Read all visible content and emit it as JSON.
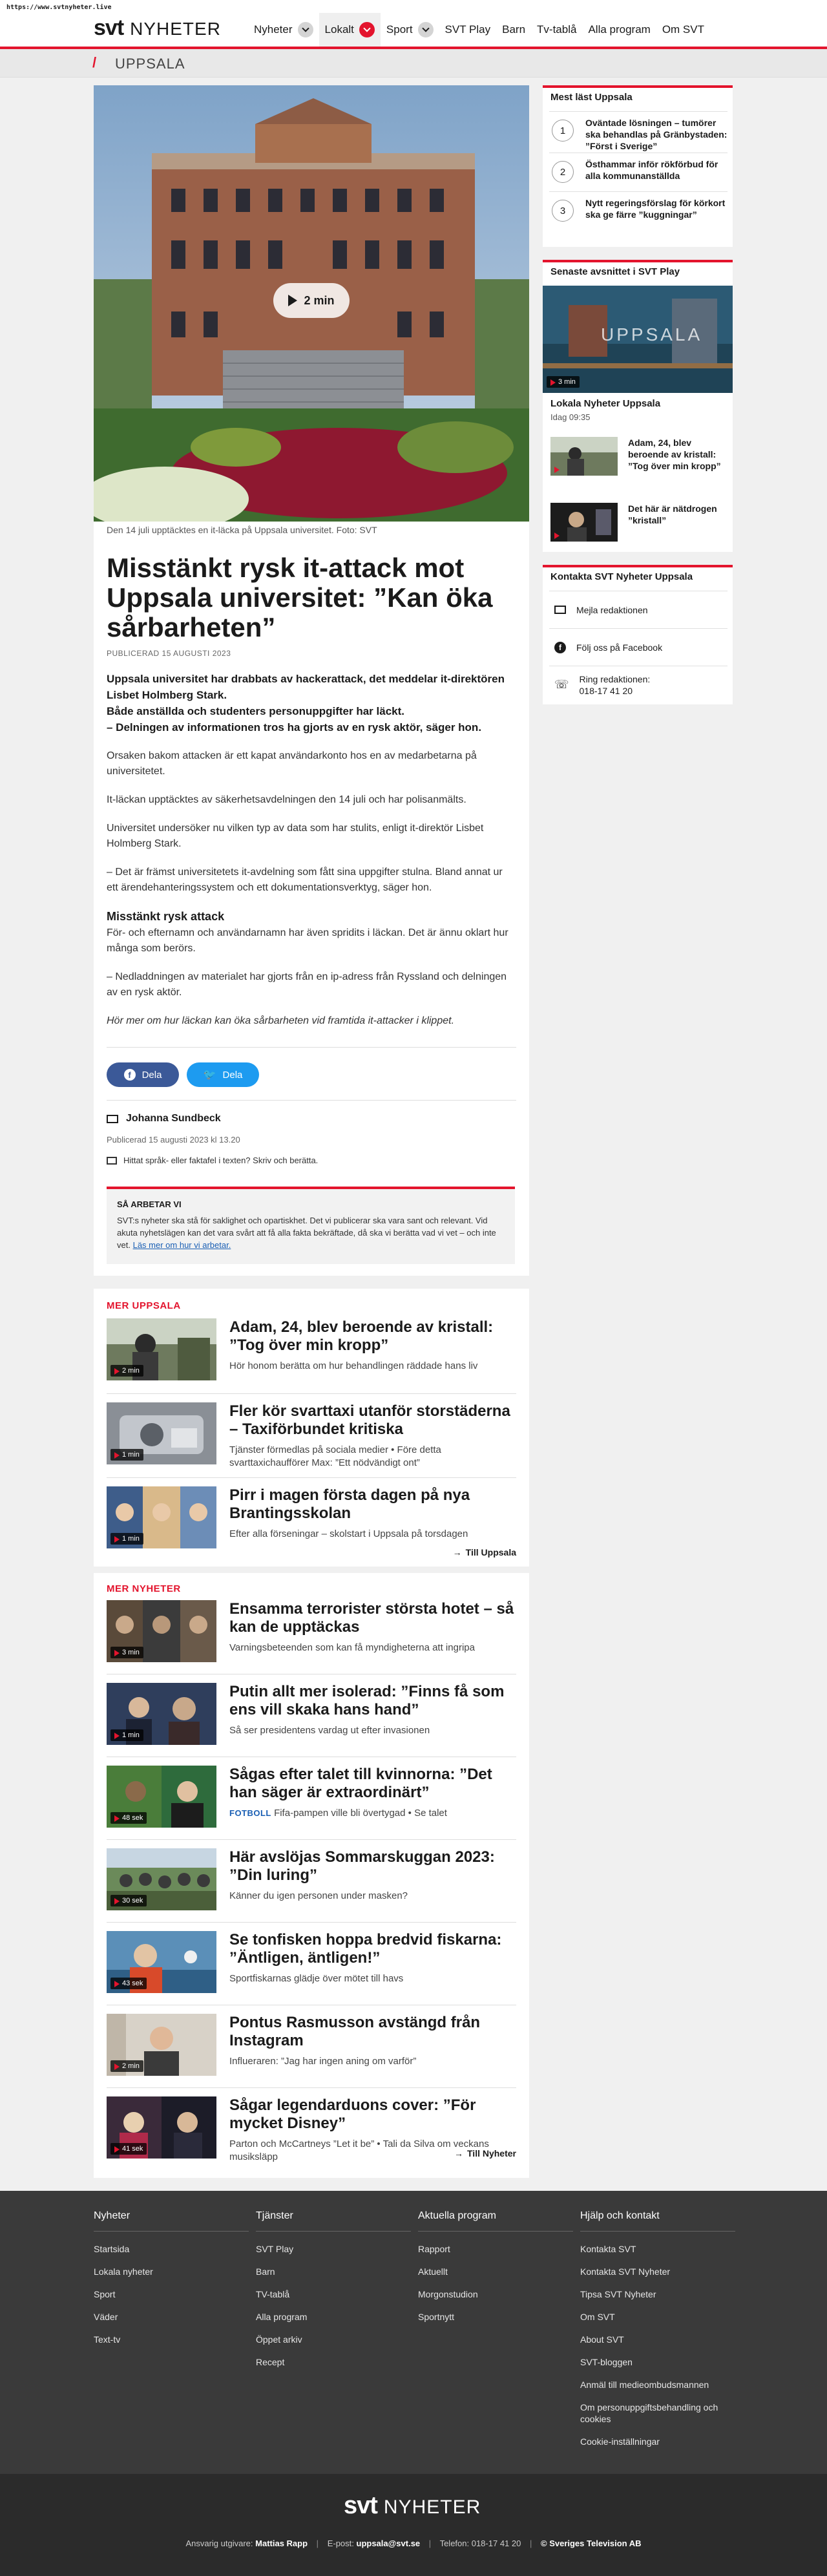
{
  "browser": {
    "url": "https://www.svtnyheter.live"
  },
  "nav": {
    "logo_svt": "svt",
    "logo_nyheter": "NYHETER",
    "items": [
      "Nyheter",
      "Lokalt",
      "Sport",
      "SVT Play",
      "Barn",
      "Tv-tablå",
      "Alla program",
      "Om SVT"
    ]
  },
  "region": {
    "name": "UPPSALA"
  },
  "article": {
    "video_duration": "2 min",
    "caption": "Den 14 juli upptäcktes en it-läcka på Uppsala universitet. Foto: SVT",
    "title": "Misstänkt rysk it-attack mot Uppsala universitet: ”Kan öka sårbarheten”",
    "published": "PUBLICERAD 15 AUGUSTI 2023",
    "lead": [
      "Uppsala universitet har drabbats av hackerattack, det meddelar it-direktören Lisbet Holmberg Stark.",
      "Både anställda och studenters personuppgifter har läckt.",
      "– Delningen av informationen tros ha gjorts av en rysk aktör, säger hon."
    ],
    "paragraphs": [
      "Orsaken bakom attacken är ett kapat användarkonto hos en av medarbetarna på universitetet.",
      "It-läckan upptäcktes av säkerhetsavdelningen den 14 juli och har polisanmälts.",
      "Universitet undersöker nu vilken typ av data som har stulits, enligt it-direktör Lisbet Holmberg Stark.",
      "– Det är främst universitetets it-avdelning som fått sina uppgifter stulna. Bland annat ur ett ärendehanteringssystem och ett dokumentationsverktyg, säger hon."
    ],
    "subheading": "Misstänkt rysk attack",
    "paragraphs2": [
      "För- och efternamn och användarnamn har även spridits i läckan. Det är ännu oklart hur många som berörs.",
      "– Nedladdningen av materialet har gjorts från en ip-adress från Ryssland och delningen av en rysk aktör."
    ],
    "italic": "Hör mer om hur läckan kan öka sårbarheten vid framtida it-attacker i klippet.",
    "share_fb": "Dela",
    "share_tw": "Dela",
    "author": "Johanna Sundbeck",
    "published_full": "Publicerad 15 augusti 2023 kl 13.20",
    "report_error": "Hittat språk- eller faktafel i texten? Skriv och berätta.",
    "how_title": "SÅ ARBETAR VI",
    "how_text": "SVT:s nyheter ska stå för saklighet och opartiskhet. Det vi publicerar ska vara sant och relevant. Vid akuta nyhetslägen kan det vara svårt att få alla fakta bekräftade, då ska vi berätta vad vi vet – och inte vet.",
    "how_link": "Läs mer om hur vi arbetar."
  },
  "more_uppsala": {
    "heading": "MER UPPSALA",
    "items": [
      {
        "title": "Adam, 24, blev beroende av kristall: ”Tog över min kropp”",
        "sub": "Hör honom berätta om hur behandlingen räddade hans liv",
        "badge": "2 min"
      },
      {
        "title": "Fler kör svarttaxi utanför storstäderna – Taxiförbundet kritiska",
        "sub": "Tjänster förmedlas på sociala medier • Före detta svarttaxichaufförer Max: ”Ett nödvändigt ont”",
        "badge": "1 min"
      },
      {
        "title": "Pirr i magen första dagen på nya Brantingsskolan",
        "sub": "Efter alla förseningar – skolstart i Uppsala på torsdagen",
        "badge": "1 min"
      }
    ],
    "more": "Till Uppsala"
  },
  "more_news": {
    "heading": "MER NYHETER",
    "items": [
      {
        "title": "Ensamma terrorister största hotet – så kan de upptäckas",
        "sub": "Varningsbeteenden som kan få myndigheterna att ingripa",
        "badge": "3 min"
      },
      {
        "title": "Putin allt mer isolerad: ”Finns få som ens vill skaka hans hand”",
        "sub": "Så ser presidentens vardag ut efter invasionen",
        "badge": "1 min"
      },
      {
        "title": "Sågas efter talet till kvinnorna: ”Det han säger är extraordinärt”",
        "tag": "FOTBOLL",
        "sub": "Fifa-pampen ville bli övertygad • Se talet",
        "badge": "48 sek"
      },
      {
        "title": "Här avslöjas Sommarskuggan 2023: ”Din luring”",
        "sub": "Känner du igen personen under masken?",
        "badge": "30 sek"
      },
      {
        "title": "Se tonfisken hoppa bredvid fiskarna: ”Äntligen, äntligen!”",
        "sub": "Sportfiskarnas glädje över mötet till havs",
        "badge": "43 sek"
      },
      {
        "title": "Pontus Rasmusson avstängd från Instagram",
        "sub": "Influeraren: ”Jag har ingen aning om varför”",
        "badge": "2 min"
      },
      {
        "title": "Sågar legendarduons cover: ”För mycket Disney”",
        "sub": "Parton och McCartneys ”Let it be” • Tali da Silva om veckans musiksläpp",
        "badge": "41 sek"
      }
    ],
    "more": "Till Nyheter"
  },
  "sidebar": {
    "most_read": {
      "heading": "Mest läst Uppsala",
      "items": [
        "Oväntade lösningen – tumörer ska behandlas på Gränbystaden: ”Först i Sverige”",
        "Östhammar inför rökförbud för alla kommunanställda",
        "Nytt regeringsförslag för körkort ska ge färre ”kuggningar”"
      ]
    },
    "play": {
      "heading": "Senaste avsnittet i SVT Play",
      "featured_title": "Lokala Nyheter Uppsala",
      "featured_time": "Idag 09:35",
      "featured_badge": "3 min",
      "featured_overlay": "UPPSALA",
      "items": [
        "Adam, 24, blev beroende av kristall: ”Tog över min kropp”",
        "Det här är nätdrogen ”kristall”"
      ]
    },
    "contact": {
      "heading": "Kontakta SVT Nyheter Uppsala",
      "rows": [
        "Mejla redaktionen",
        "Följ oss på Facebook",
        "Ring redaktionen:",
        "018-17 41 20"
      ]
    }
  },
  "footer": {
    "cols": [
      {
        "head": "Nyheter",
        "links": [
          "Startsida",
          "Lokala nyheter",
          "Sport",
          "Väder",
          "Text-tv"
        ]
      },
      {
        "head": "Tjänster",
        "links": [
          "SVT Play",
          "Barn",
          "TV-tablå",
          "Alla program",
          "Öppet arkiv",
          "Recept"
        ]
      },
      {
        "head": "Aktuella program",
        "links": [
          "Rapport",
          "Aktuellt",
          "Morgonstudion",
          "Sportnytt"
        ]
      },
      {
        "head": "Hjälp och kontakt",
        "links": [
          "Kontakta SVT",
          "Kontakta SVT Nyheter",
          "Tipsa SVT Nyheter",
          "Om SVT",
          "About SVT",
          "SVT-bloggen",
          "Anmäl till medieombudsmannen",
          "Om personuppgiftsbehandling och cookies",
          "Cookie-inställningar"
        ]
      }
    ],
    "logo_svt": "svt",
    "logo_nyheter": "NYHETER",
    "publisher_label": "Ansvarig utgivare:",
    "publisher": "Mattias Rapp",
    "email_label": "E-post:",
    "email": "uppsala@svt.se",
    "phone": "Telefon: 018-17 41 20",
    "copyright": "© Sveriges Television AB"
  }
}
